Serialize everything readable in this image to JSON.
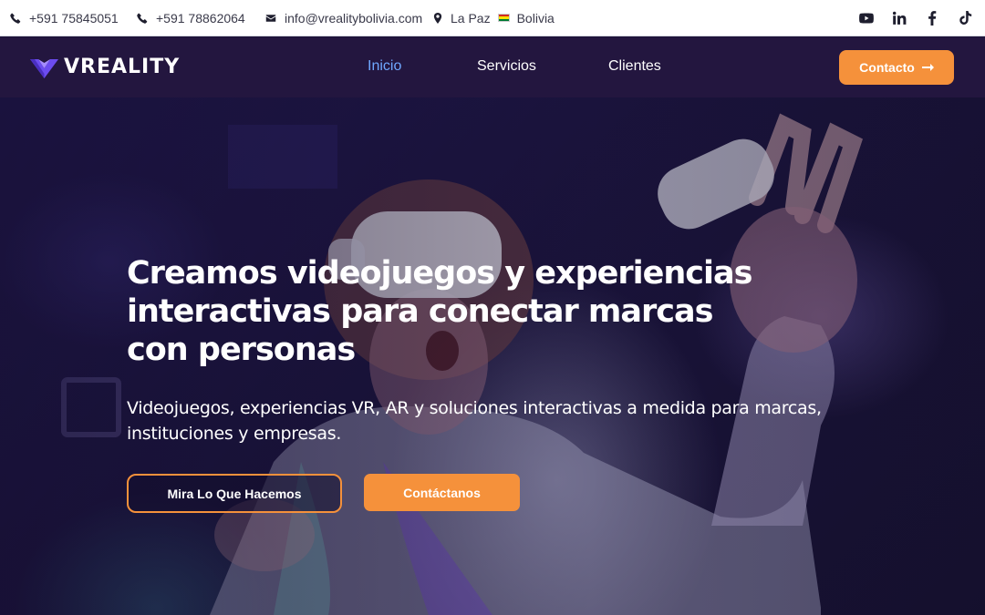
{
  "topbar": {
    "phone1": "+591 75845051",
    "phone2": "+591 78862064",
    "email": "info@vrealitybolivia.com",
    "location_city": "La Paz",
    "location_country": "Bolivia",
    "social": [
      "youtube-icon",
      "linkedin-icon",
      "facebook-icon",
      "tiktok-icon"
    ]
  },
  "nav": {
    "logo_text": "VREALITY",
    "links": [
      {
        "label": "Inicio",
        "active": true
      },
      {
        "label": "Servicios",
        "active": false
      },
      {
        "label": "Clientes",
        "active": false
      }
    ],
    "cta_label": "Contacto"
  },
  "hero": {
    "title": "Creamos videojuegos y experiencias interactivas para conectar marcas con personas",
    "subtitle": "Videojuegos, experiencias VR, AR y soluciones interactivas a medida para marcas, instituciones y empresas.",
    "primary_button": "Mira Lo Que Hacemos",
    "secondary_button": "Contáctanos"
  },
  "colors": {
    "accent": "#f5913b",
    "nav_bg": "#23163f",
    "active_link": "#6fa8ff",
    "logo_purple": "#6c4cf0",
    "flag": [
      "#d52b1e",
      "#f9e300",
      "#007a33"
    ]
  }
}
